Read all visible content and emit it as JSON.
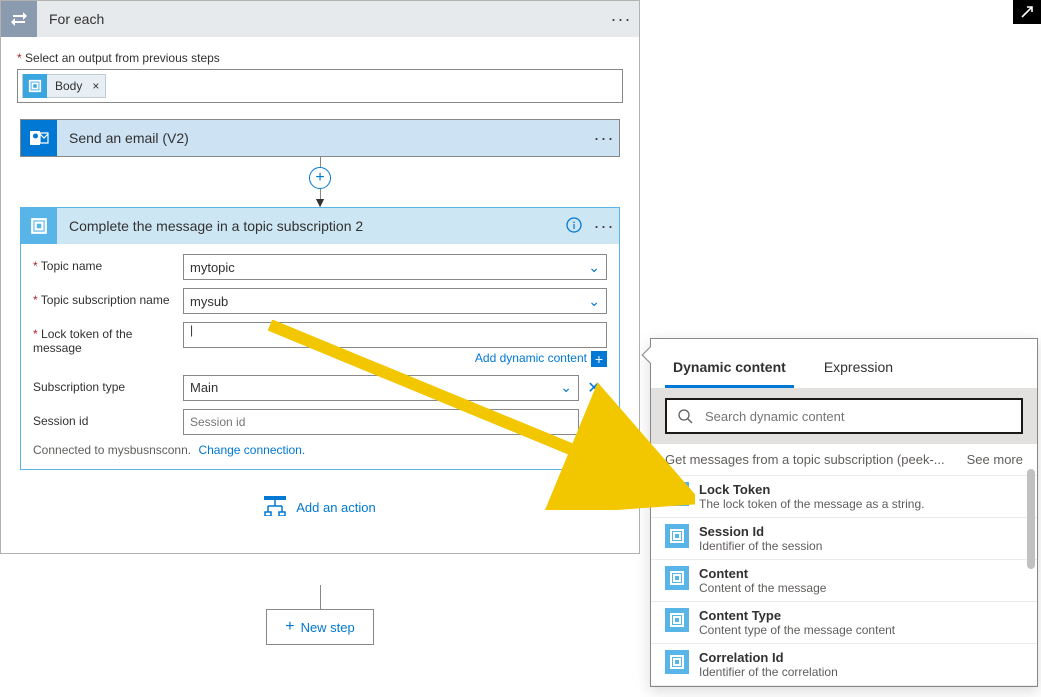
{
  "foreach": {
    "title": "For each"
  },
  "select_output_label": "Select an output from previous steps",
  "body_token": "Body",
  "email_card": {
    "title": "Send an email (V2)"
  },
  "complete_card": {
    "title": "Complete the message in a topic subscription 2",
    "topic_name_label": "Topic name",
    "topic_name_value": "mytopic",
    "subscription_label": "Topic subscription name",
    "subscription_value": "mysub",
    "lock_token_label": "Lock token of the message",
    "lock_token_value": "",
    "add_dynamic": "Add dynamic content",
    "sub_type_label": "Subscription type",
    "sub_type_value": "Main",
    "session_id_label": "Session id",
    "session_id_placeholder": "Session id",
    "connected_prefix": "Connected to mysbusnsconn.",
    "change_conn": "Change connection."
  },
  "add_action": "Add an action",
  "new_step": "New step",
  "dc": {
    "tab_dynamic": "Dynamic content",
    "tab_expression": "Expression",
    "search_placeholder": "Search dynamic content",
    "section": "Get messages from a topic subscription (peek-...",
    "see_more": "See more",
    "items": [
      {
        "title": "Lock Token",
        "desc": "The lock token of the message as a string."
      },
      {
        "title": "Session Id",
        "desc": "Identifier of the session"
      },
      {
        "title": "Content",
        "desc": "Content of the message"
      },
      {
        "title": "Content Type",
        "desc": "Content type of the message content"
      },
      {
        "title": "Correlation Id",
        "desc": "Identifier of the correlation"
      }
    ]
  }
}
